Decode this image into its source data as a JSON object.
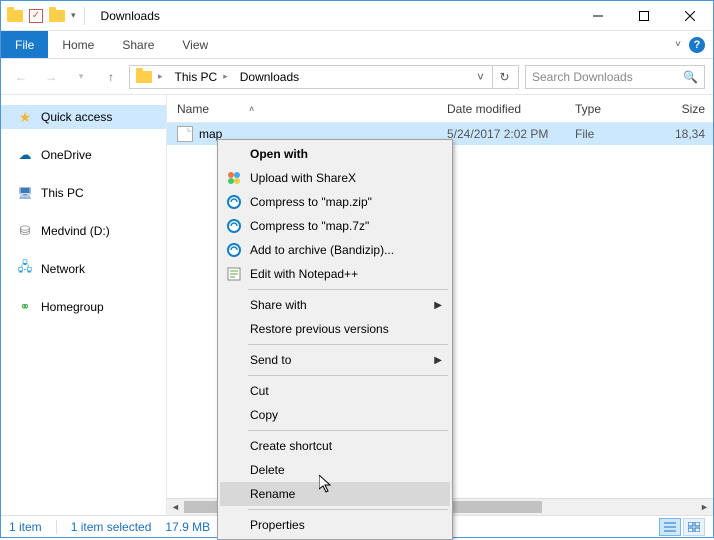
{
  "window": {
    "title": "Downloads"
  },
  "ribbon": {
    "file": "File",
    "tabs": [
      "Home",
      "Share",
      "View"
    ]
  },
  "breadcrumb": {
    "items": [
      "This PC",
      "Downloads"
    ]
  },
  "search": {
    "placeholder": "Search Downloads"
  },
  "navpane": {
    "items": [
      {
        "label": "Quick access",
        "icon": "star",
        "active": true
      },
      {
        "label": "OneDrive",
        "icon": "cloud"
      },
      {
        "label": "This PC",
        "icon": "pc"
      },
      {
        "label": "Medvind (D:)",
        "icon": "drive"
      },
      {
        "label": "Network",
        "icon": "net"
      },
      {
        "label": "Homegroup",
        "icon": "hg"
      }
    ]
  },
  "columns": {
    "name": "Name",
    "date": "Date modified",
    "type": "Type",
    "size": "Size"
  },
  "files": [
    {
      "name": "map",
      "date": "5/24/2017 2:02 PM",
      "type": "File",
      "size": "18,34"
    }
  ],
  "context_menu": {
    "items": [
      {
        "label": "Open with",
        "bold": true
      },
      {
        "label": "Upload with ShareX",
        "icon": "sharex"
      },
      {
        "label": "Compress to \"map.zip\"",
        "icon": "bandizip"
      },
      {
        "label": "Compress to \"map.7z\"",
        "icon": "bandizip"
      },
      {
        "label": "Add to archive (Bandizip)...",
        "icon": "bandizip"
      },
      {
        "label": "Edit with Notepad++",
        "icon": "npp"
      },
      {
        "sep": true
      },
      {
        "label": "Share with",
        "submenu": true
      },
      {
        "label": "Restore previous versions"
      },
      {
        "sep": true
      },
      {
        "label": "Send to",
        "submenu": true
      },
      {
        "sep": true
      },
      {
        "label": "Cut"
      },
      {
        "label": "Copy"
      },
      {
        "sep": true
      },
      {
        "label": "Create shortcut"
      },
      {
        "label": "Delete"
      },
      {
        "label": "Rename",
        "hovered": true
      },
      {
        "sep": true
      },
      {
        "label": "Properties"
      }
    ]
  },
  "status": {
    "count": "1 item",
    "selected": "1 item selected",
    "size": "17.9 MB"
  }
}
